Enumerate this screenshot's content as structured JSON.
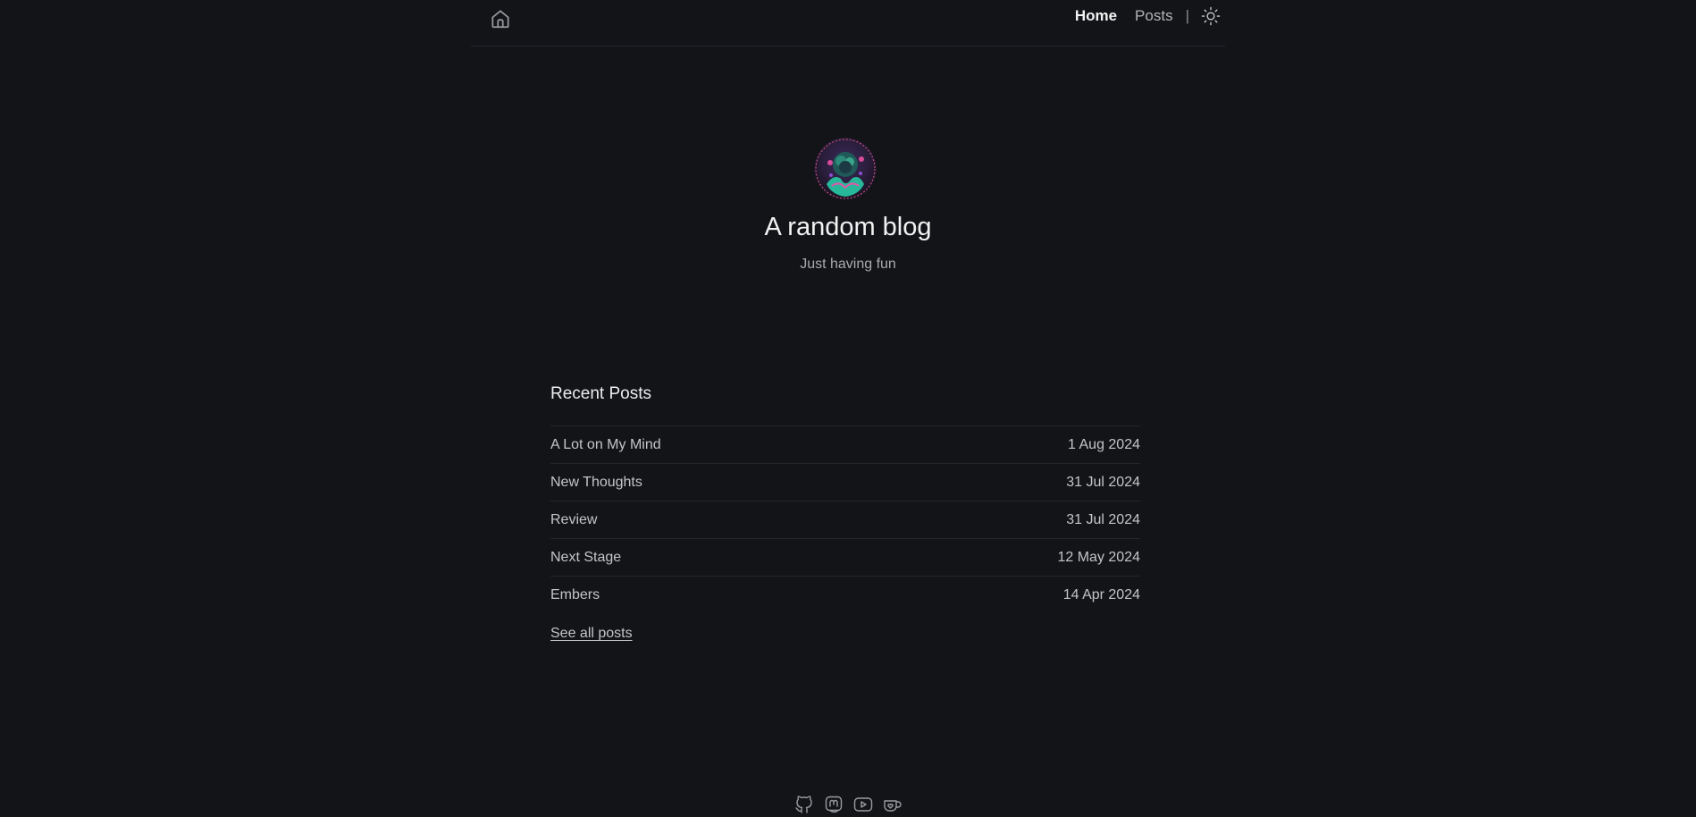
{
  "header": {
    "home_icon": "home-icon",
    "nav": {
      "home": "Home",
      "posts": "Posts",
      "separator": "|"
    },
    "theme_icon": "sun-icon"
  },
  "hero": {
    "title": "A random blog",
    "subtitle": "Just having fun"
  },
  "recent": {
    "heading": "Recent Posts",
    "posts": [
      {
        "title": "A Lot on My Mind",
        "date": "1 Aug 2024"
      },
      {
        "title": "New Thoughts",
        "date": "31 Jul 2024"
      },
      {
        "title": "Review",
        "date": "31 Jul 2024"
      },
      {
        "title": "Next Stage",
        "date": "12 May 2024"
      },
      {
        "title": "Embers",
        "date": "14 Apr 2024"
      }
    ],
    "see_all": "See all posts"
  },
  "footer": {
    "icons": [
      "github-icon",
      "mastodon-icon",
      "youtube-icon",
      "kofi-icon"
    ]
  },
  "colors": {
    "background": "#131418",
    "text": "#e6e6e6",
    "muted": "#a9aaae",
    "divider": "#24262c"
  }
}
